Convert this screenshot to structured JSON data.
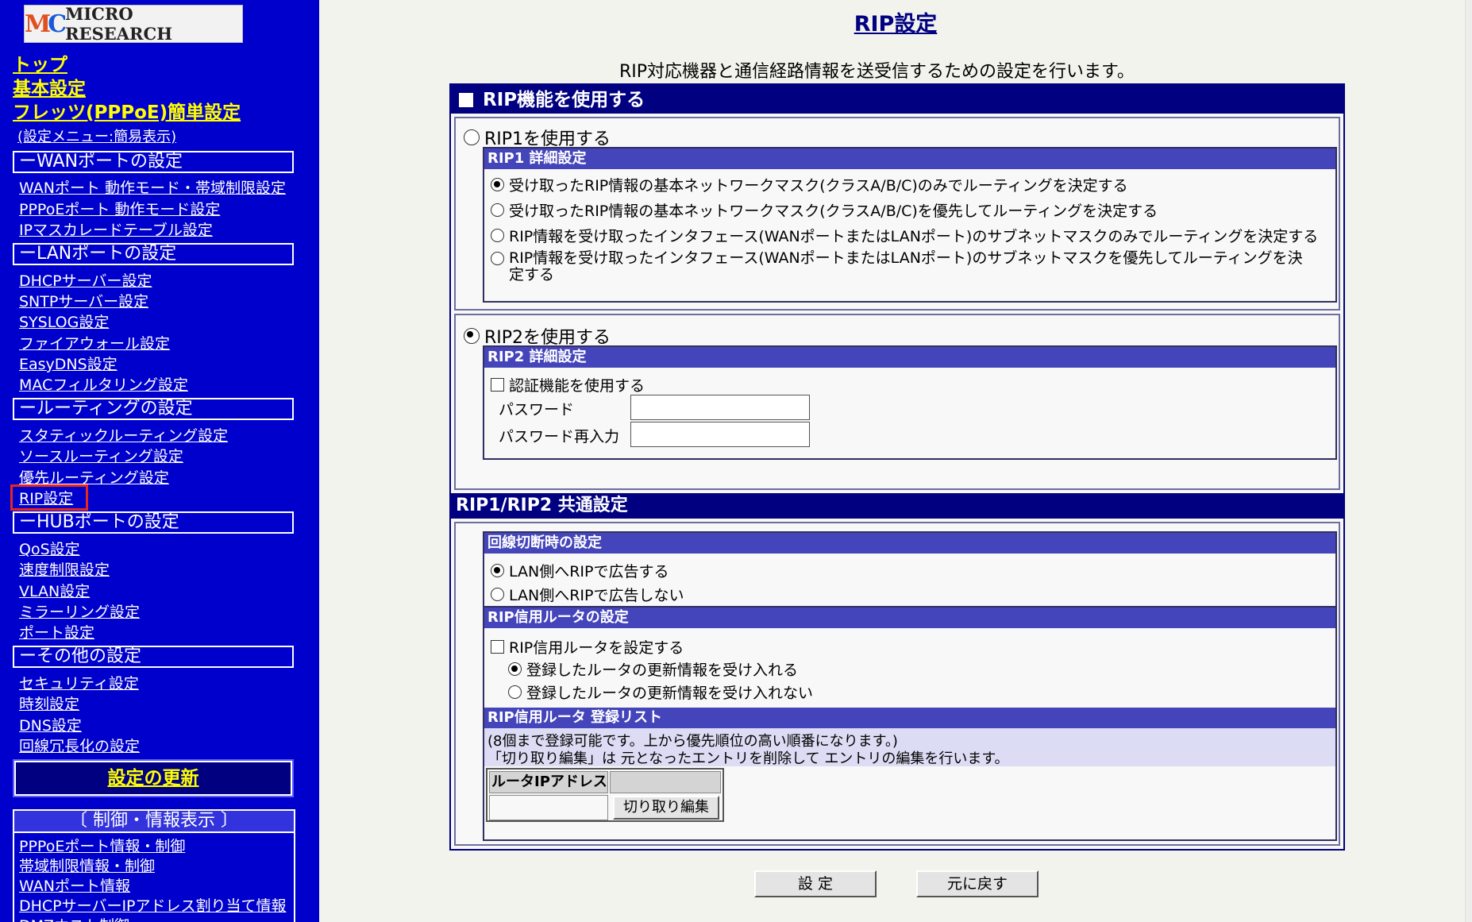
{
  "logo": {
    "text": "MICRO RESEARCH"
  },
  "sidebar": {
    "top_links": [
      "トップ",
      "基本設定",
      "フレッツ(PPPoE)簡単設定"
    ],
    "menu_mode": "(設定メニュー:簡易表示)",
    "sections": [
      {
        "title": "ーWANポートの設定",
        "items": [
          "WANポート 動作モード・帯域制限設定",
          "PPPoEポート 動作モード設定",
          "IPマスカレードテーブル設定"
        ]
      },
      {
        "title": "ーLANポートの設定",
        "items": [
          "DHCPサーバー設定",
          "SNTPサーバー設定",
          "SYSLOG設定",
          "ファイアウォール設定",
          "EasyDNS設定",
          "MACフィルタリング設定"
        ]
      },
      {
        "title": "ールーティングの設定",
        "items": [
          "スタティックルーティング設定",
          "ソースルーティング設定",
          "優先ルーティング設定",
          "RIP設定"
        ]
      },
      {
        "title": "ーHUBポートの設定",
        "items": [
          "QoS設定",
          "速度制限設定",
          "VLAN設定",
          "ミラーリング設定",
          "ポート設定"
        ]
      },
      {
        "title": "ーその他の設定",
        "items": [
          "セキュリティ設定",
          "時刻設定",
          "DNS設定",
          "回線冗長化の設定"
        ]
      }
    ],
    "update_button": "設定の更新",
    "control_header": "〔 制御・情報表示 〕",
    "control_items": [
      "PPPoEポート情報・制御",
      "帯域制限情報・制御",
      "WANポート情報",
      "DHCPサーバーIPアドレス割り当て情報",
      "DMZホスト制御"
    ]
  },
  "main": {
    "title": "RIP設定",
    "description": "RIP対応機器と通信経路情報を送受信するための設定を行います。",
    "enable_label": "RIP機能を使用する",
    "enable_checked": false,
    "rip1": {
      "label": "RIP1を使用する",
      "selected": false,
      "detail_header": "RIP1 詳細設定",
      "options": [
        "受け取ったRIP情報の基本ネットワークマスク(クラスA/B/C)のみでルーティングを決定する",
        "受け取ったRIP情報の基本ネットワークマスク(クラスA/B/C)を優先してルーティングを決定する",
        "RIP情報を受け取ったインタフェース(WANポートまたはLANポート)のサブネットマスクのみでルーティングを決定する",
        "RIP情報を受け取ったインタフェース(WANポートまたはLANポート)のサブネットマスクを優先してルーティングを決定する"
      ],
      "selected_option": 0
    },
    "rip2": {
      "label": "RIP2を使用する",
      "selected": true,
      "detail_header": "RIP2 詳細設定",
      "auth_label": "認証機能を使用する",
      "password_label": "パスワード",
      "password_value": "",
      "password_confirm_label": "パスワード再入力",
      "password_confirm_value": ""
    },
    "common": {
      "header": "RIP1/RIP2 共通設定",
      "disconnect_header": "回線切断時の設定",
      "disconnect_options": [
        "LAN側へRIPで広告する",
        "LAN側へRIPで広告しない"
      ],
      "disconnect_selected": 0,
      "trusted_header": "RIP信用ルータの設定",
      "trusted_check_label": "RIP信用ルータを設定する",
      "trusted_options": [
        "登録したルータの更新情報を受け入れる",
        "登録したルータの更新情報を受け入れない"
      ],
      "trusted_selected": 0,
      "list_header": "RIP信用ルータ 登録リスト",
      "list_note_1": "(8個まで登録可能です。上から優先順位の高い順番になります。)",
      "list_note_2": "「切り取り編集」は 元となったエントリを削除して エントリの編集を行います。",
      "col_router_ip": "ルータIPアドレス",
      "cut_edit_button": "切り取り編集"
    },
    "submit_button": "設 定",
    "reset_button": "元に戻す"
  }
}
